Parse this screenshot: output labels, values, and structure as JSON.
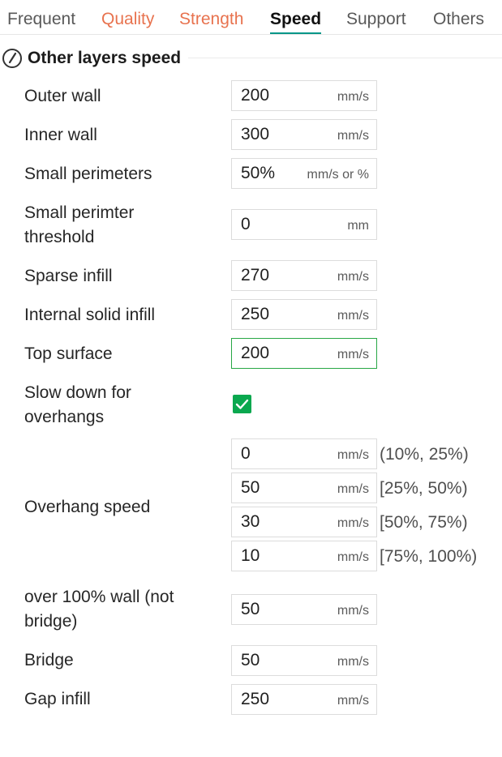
{
  "tabs": [
    {
      "label": "Frequent"
    },
    {
      "label": "Quality"
    },
    {
      "label": "Strength"
    },
    {
      "label": "Speed"
    },
    {
      "label": "Support"
    },
    {
      "label": "Others"
    }
  ],
  "section": {
    "title": "Other layers speed",
    "icon": "speedometer-icon"
  },
  "fields": {
    "outer_wall": {
      "label": "Outer wall",
      "value": "200",
      "unit": "mm/s"
    },
    "inner_wall": {
      "label": "Inner wall",
      "value": "300",
      "unit": "mm/s"
    },
    "small_perimeters": {
      "label": "Small perimeters",
      "value": "50%",
      "unit": "mm/s or %"
    },
    "small_perimeter_threshold": {
      "label_line1": "Small perimter",
      "label_line2": "threshold",
      "value": "0",
      "unit": "mm"
    },
    "sparse_infill": {
      "label": "Sparse infill",
      "value": "270",
      "unit": "mm/s"
    },
    "internal_solid_infill": {
      "label": "Internal solid infill",
      "value": "250",
      "unit": "mm/s"
    },
    "top_surface": {
      "label": "Top surface",
      "value": "200",
      "unit": "mm/s"
    },
    "slow_down_overhangs": {
      "label_line1": "Slow down for",
      "label_line2": "overhangs",
      "checked": true
    },
    "overhang_speed": {
      "label": "Overhang speed",
      "rows": [
        {
          "value": "0",
          "unit": "mm/s",
          "range": "(10%, 25%)"
        },
        {
          "value": "50",
          "unit": "mm/s",
          "range": "[25%, 50%)"
        },
        {
          "value": "30",
          "unit": "mm/s",
          "range": "[50%, 75%)"
        },
        {
          "value": "10",
          "unit": "mm/s",
          "range": "[75%, 100%)"
        }
      ]
    },
    "over_100_wall": {
      "label_line1": "over 100% wall (not",
      "label_line2": "bridge)",
      "value": "50",
      "unit": "mm/s"
    },
    "bridge": {
      "label": "Bridge",
      "value": "50",
      "unit": "mm/s"
    },
    "gap_infill": {
      "label": "Gap infill",
      "value": "250",
      "unit": "mm/s"
    }
  },
  "colors": {
    "modified_tab": "#e8734f",
    "active_underline": "#009688",
    "checkbox": "#0aa84f",
    "focus_border": "#27a745"
  }
}
